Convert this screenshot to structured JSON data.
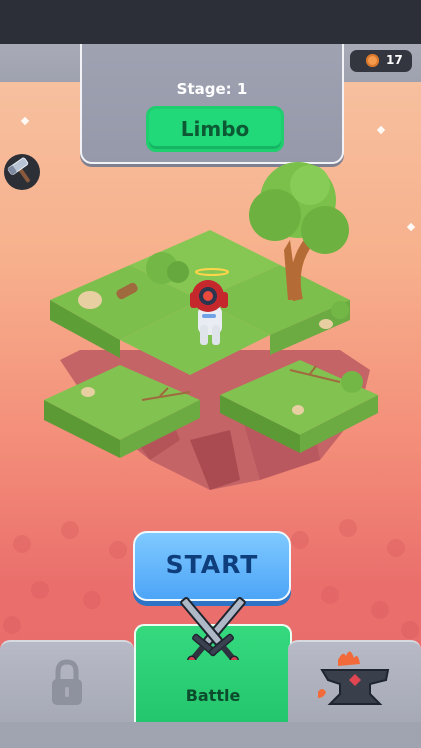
{
  "header": {
    "stage_label": "Stage: 1",
    "stage_name": "Limbo"
  },
  "currency": {
    "icon": "coin-icon",
    "count": "17",
    "color": "#f39a4d"
  },
  "side_tools": {
    "icon": "hammer-icon"
  },
  "main": {
    "start_label": "START"
  },
  "bottom_tabs": [
    {
      "icon": "lock-icon",
      "label": "",
      "locked": true
    },
    {
      "icon": "crossed-swords-icon",
      "label": "Battle",
      "selected": true
    },
    {
      "icon": "anvil-icon",
      "label": ""
    }
  ],
  "colors": {
    "accent_green": "#22d97a",
    "start_blue": "#4da5f7",
    "bg_top": "#f7c7a7",
    "bg_bottom": "#e66a6a"
  }
}
